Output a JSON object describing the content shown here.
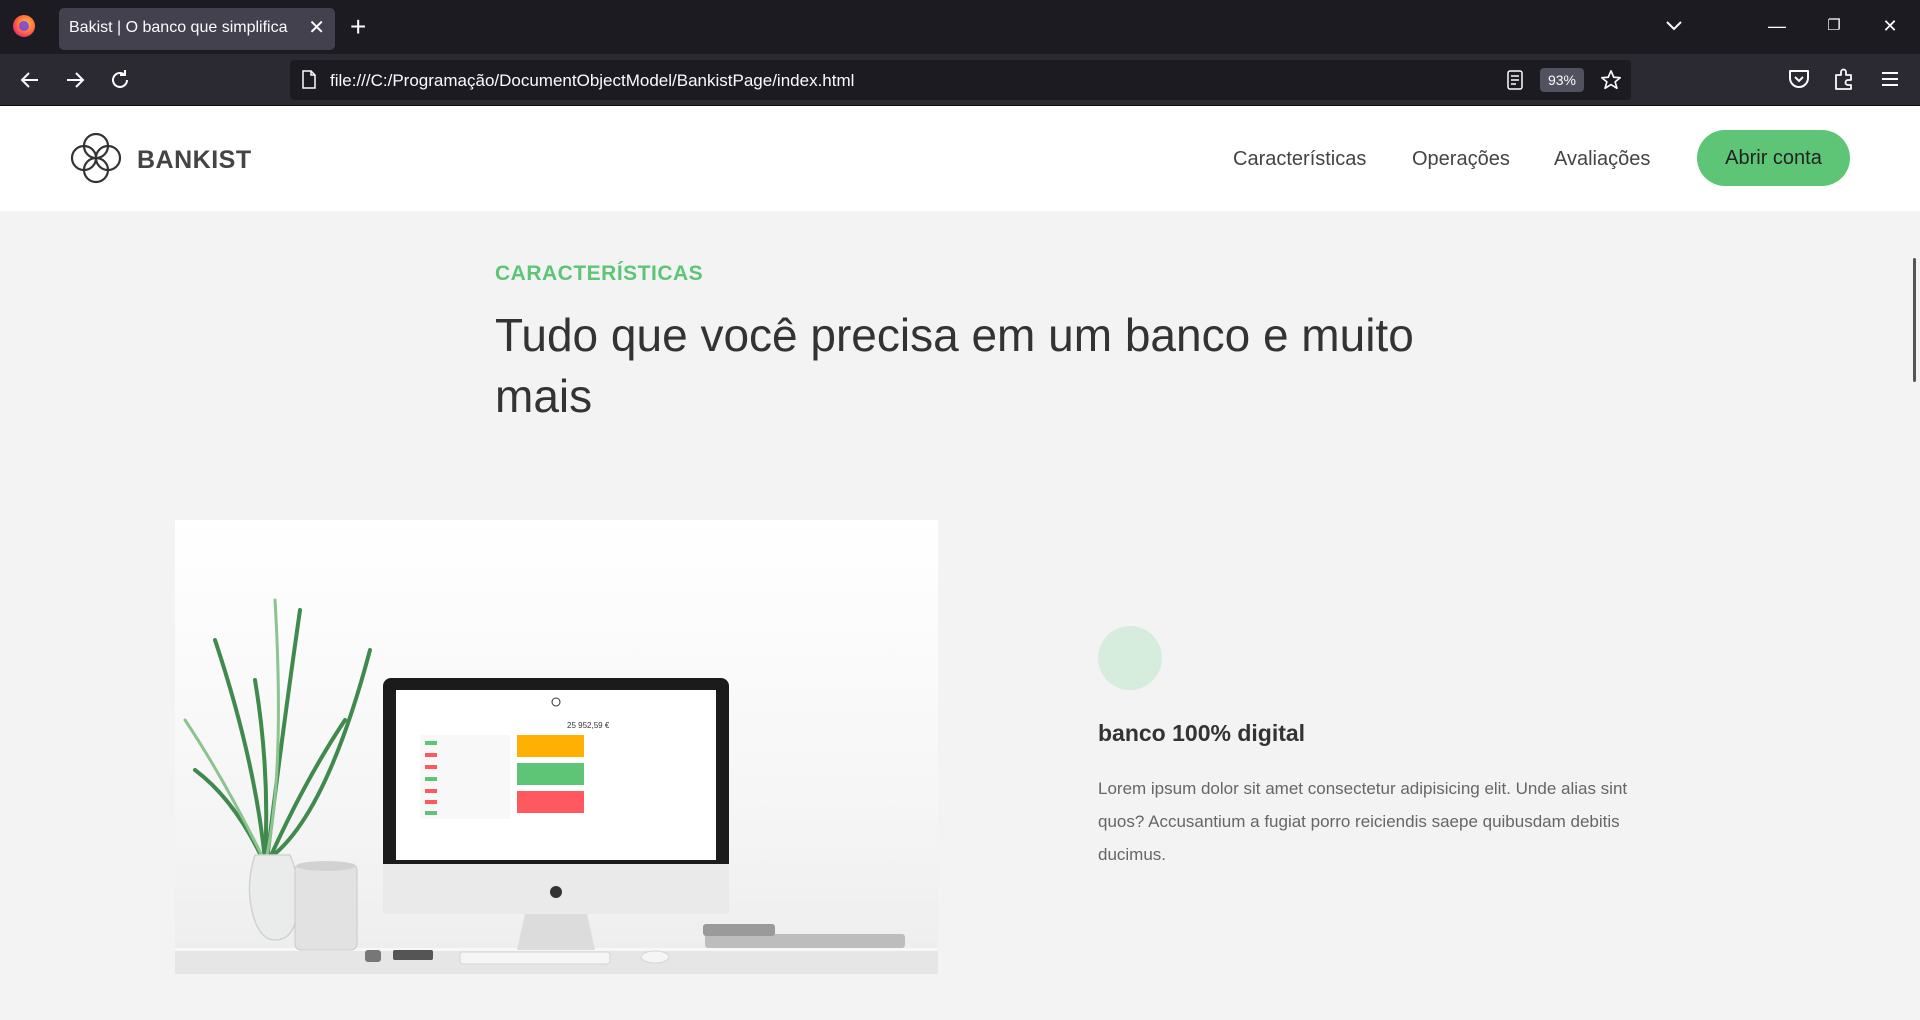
{
  "browser": {
    "tab_title": "Bakist | O banco que simplifica",
    "tab_close": "✕",
    "new_tab": "+",
    "url": "file:///C:/Programação/DocumentObjectModel/BankistPage/index.html",
    "zoom": "93%",
    "window_controls": {
      "minimize": "—",
      "restore": "❐",
      "close": "✕"
    }
  },
  "site": {
    "logo_text": "BANKIST",
    "nav": {
      "features": "Características",
      "operations": "Operações",
      "reviews": "Avaliações",
      "cta": "Abrir conta"
    },
    "accent_color": "#5ec576"
  },
  "features_section": {
    "label": "CARACTERÍSTICAS",
    "title": "Tudo que você precisa em um banco e muito mais",
    "feature": {
      "icon": "circle-icon",
      "title": "banco 100% digital",
      "text": "Lorem ipsum dolor sit amet consectetur adipisicing elit. Unde alias sint quos? Accusantium a fugiat porro reiciendis saepe quibusdam debitis ducimus."
    }
  },
  "photo_screen": {
    "balance": "25 952,59 €"
  }
}
